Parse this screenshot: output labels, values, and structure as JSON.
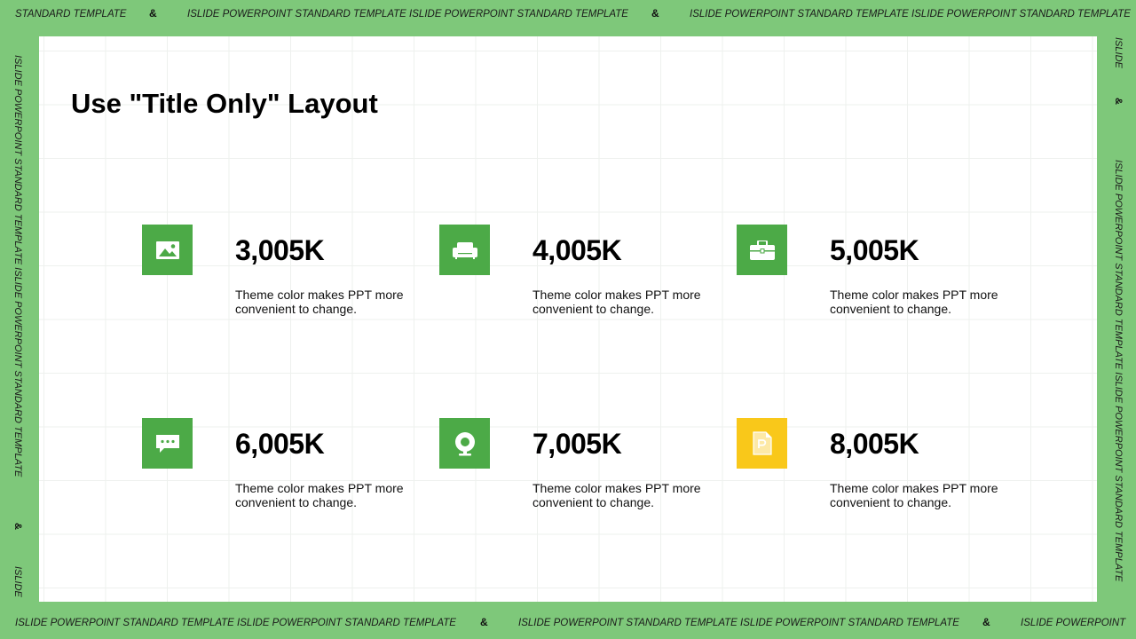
{
  "frame": {
    "top": {
      "segments": [
        "STANDARD TEMPLATE",
        "ISLIDE POWERPOINT STANDARD TEMPLATE ISLIDE POWERPOINT STANDARD TEMPLATE",
        "ISLIDE POWERPOINT STANDARD TEMPLATE ISLIDE POWERPOINT STANDARD TEMPLATE"
      ],
      "amp": "&"
    },
    "bottom": {
      "segments": [
        "ISLIDE POWERPOINT STANDARD TEMPLATE ISLIDE POWERPOINT STANDARD TEMPLATE",
        "ISLIDE POWERPOINT STANDARD TEMPLATE ISLIDE POWERPOINT STANDARD TEMPLATE",
        "ISLIDE POWERPOINT"
      ],
      "amp": "&"
    },
    "left": {
      "main": "ISLIDE POWERPOINT STANDARD TEMPLATE ISLIDE POWERPOINT STANDARD TEMPLATE",
      "tail": "ISLIDE",
      "amp": "&"
    },
    "right": {
      "head": "ISLIDE",
      "main": "ISLIDE POWERPOINT STANDARD TEMPLATE ISLIDE POWERPOINT STANDARD TEMPLATE",
      "amp": "&"
    }
  },
  "slide": {
    "title": "Use \"Title Only\" Layout",
    "cards": [
      {
        "value": "3,005K",
        "desc": "Theme color makes PPT more convenient  to change.",
        "icon": "image-icon",
        "color": "#4caa47"
      },
      {
        "value": "4,005K",
        "desc": "Theme color makes PPT more convenient  to change.",
        "icon": "sofa-icon",
        "color": "#4caa47"
      },
      {
        "value": "5,005K",
        "desc": "Theme color makes PPT more convenient  to change.",
        "icon": "briefcase-icon",
        "color": "#4caa47"
      },
      {
        "value": "6,005K",
        "desc": "Theme color makes PPT more convenient  to change.",
        "icon": "chat-icon",
        "color": "#4caa47"
      },
      {
        "value": "7,005K",
        "desc": "Theme color makes PPT more convenient  to change.",
        "icon": "webcam-icon",
        "color": "#4caa47"
      },
      {
        "value": "8,005K",
        "desc": "Theme color makes PPT more convenient  to change.",
        "icon": "ppt-file-icon",
        "color": "#f9c81a"
      }
    ]
  },
  "colors": {
    "frame": "#7ec87a",
    "accent_green": "#4caa47",
    "accent_yellow": "#f9c81a"
  }
}
